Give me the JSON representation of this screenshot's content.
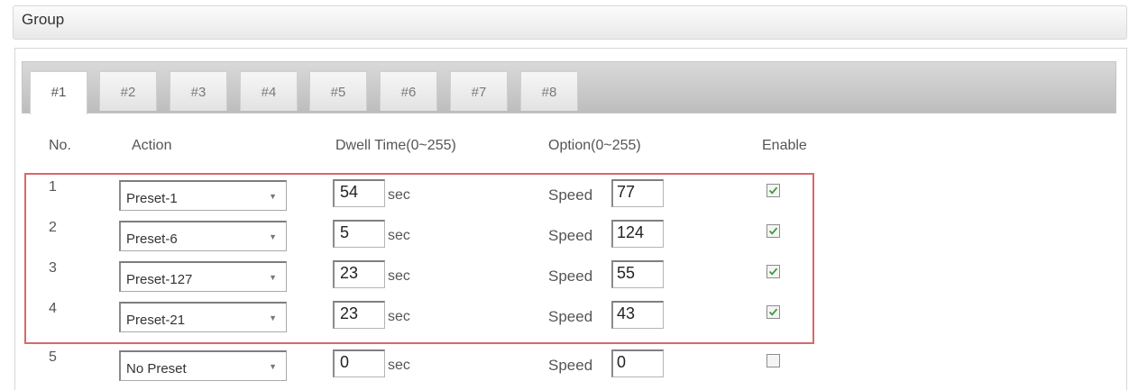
{
  "group": {
    "title": "Group"
  },
  "tabs": [
    {
      "label": "#1",
      "active": true
    },
    {
      "label": "#2",
      "active": false
    },
    {
      "label": "#3",
      "active": false
    },
    {
      "label": "#4",
      "active": false
    },
    {
      "label": "#5",
      "active": false
    },
    {
      "label": "#6",
      "active": false
    },
    {
      "label": "#7",
      "active": false
    },
    {
      "label": "#8",
      "active": false
    }
  ],
  "columns": {
    "no": "No.",
    "action": "Action",
    "dwell": "Dwell Time(0~255)",
    "option": "Option(0~255)",
    "enable": "Enable"
  },
  "rows": [
    {
      "no": "1",
      "action": "Preset-1",
      "dwell": "54",
      "unit": "sec",
      "speed_label": "Speed",
      "speed": "77",
      "enabled": true
    },
    {
      "no": "2",
      "action": "Preset-6",
      "dwell": "5",
      "unit": "sec",
      "speed_label": "Speed",
      "speed": "124",
      "enabled": true
    },
    {
      "no": "3",
      "action": "Preset-127",
      "dwell": "23",
      "unit": "sec",
      "speed_label": "Speed",
      "speed": "55",
      "enabled": true
    },
    {
      "no": "4",
      "action": "Preset-21",
      "dwell": "23",
      "unit": "sec",
      "speed_label": "Speed",
      "speed": "43",
      "enabled": true
    },
    {
      "no": "5",
      "action": "No Preset",
      "dwell": "0",
      "unit": "sec",
      "speed_label": "Speed",
      "speed": "0",
      "enabled": false
    }
  ],
  "colors": {
    "highlight": "#d9686c",
    "check": "#3a9a3a"
  },
  "icons": {
    "select_arrow": "dropdown-arrow-icon",
    "check": "checkmark-icon"
  }
}
